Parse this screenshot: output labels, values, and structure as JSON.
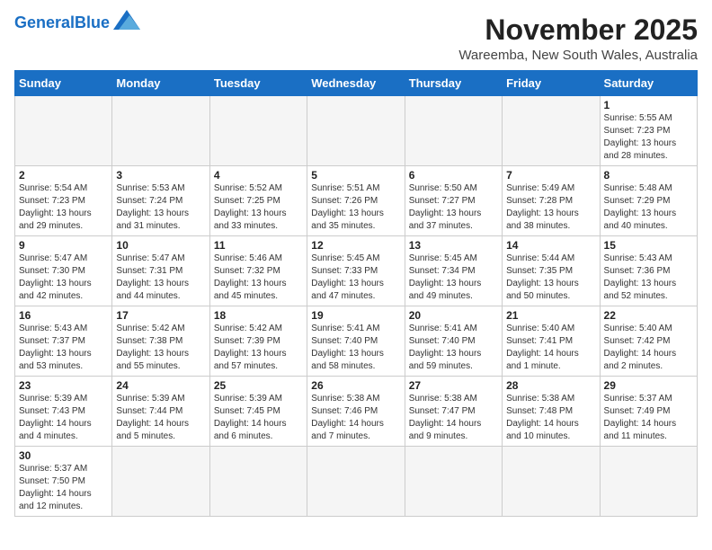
{
  "header": {
    "logo_general": "General",
    "logo_blue": "Blue",
    "month_title": "November 2025",
    "location": "Wareemba, New South Wales, Australia"
  },
  "days_of_week": [
    "Sunday",
    "Monday",
    "Tuesday",
    "Wednesday",
    "Thursday",
    "Friday",
    "Saturday"
  ],
  "weeks": [
    [
      {
        "day": "",
        "info": ""
      },
      {
        "day": "",
        "info": ""
      },
      {
        "day": "",
        "info": ""
      },
      {
        "day": "",
        "info": ""
      },
      {
        "day": "",
        "info": ""
      },
      {
        "day": "",
        "info": ""
      },
      {
        "day": "1",
        "info": "Sunrise: 5:55 AM\nSunset: 7:23 PM\nDaylight: 13 hours\nand 28 minutes."
      }
    ],
    [
      {
        "day": "2",
        "info": "Sunrise: 5:54 AM\nSunset: 7:23 PM\nDaylight: 13 hours\nand 29 minutes."
      },
      {
        "day": "3",
        "info": "Sunrise: 5:53 AM\nSunset: 7:24 PM\nDaylight: 13 hours\nand 31 minutes."
      },
      {
        "day": "4",
        "info": "Sunrise: 5:52 AM\nSunset: 7:25 PM\nDaylight: 13 hours\nand 33 minutes."
      },
      {
        "day": "5",
        "info": "Sunrise: 5:51 AM\nSunset: 7:26 PM\nDaylight: 13 hours\nand 35 minutes."
      },
      {
        "day": "6",
        "info": "Sunrise: 5:50 AM\nSunset: 7:27 PM\nDaylight: 13 hours\nand 37 minutes."
      },
      {
        "day": "7",
        "info": "Sunrise: 5:49 AM\nSunset: 7:28 PM\nDaylight: 13 hours\nand 38 minutes."
      },
      {
        "day": "8",
        "info": "Sunrise: 5:48 AM\nSunset: 7:29 PM\nDaylight: 13 hours\nand 40 minutes."
      }
    ],
    [
      {
        "day": "9",
        "info": "Sunrise: 5:47 AM\nSunset: 7:30 PM\nDaylight: 13 hours\nand 42 minutes."
      },
      {
        "day": "10",
        "info": "Sunrise: 5:47 AM\nSunset: 7:31 PM\nDaylight: 13 hours\nand 44 minutes."
      },
      {
        "day": "11",
        "info": "Sunrise: 5:46 AM\nSunset: 7:32 PM\nDaylight: 13 hours\nand 45 minutes."
      },
      {
        "day": "12",
        "info": "Sunrise: 5:45 AM\nSunset: 7:33 PM\nDaylight: 13 hours\nand 47 minutes."
      },
      {
        "day": "13",
        "info": "Sunrise: 5:45 AM\nSunset: 7:34 PM\nDaylight: 13 hours\nand 49 minutes."
      },
      {
        "day": "14",
        "info": "Sunrise: 5:44 AM\nSunset: 7:35 PM\nDaylight: 13 hours\nand 50 minutes."
      },
      {
        "day": "15",
        "info": "Sunrise: 5:43 AM\nSunset: 7:36 PM\nDaylight: 13 hours\nand 52 minutes."
      }
    ],
    [
      {
        "day": "16",
        "info": "Sunrise: 5:43 AM\nSunset: 7:37 PM\nDaylight: 13 hours\nand 53 minutes."
      },
      {
        "day": "17",
        "info": "Sunrise: 5:42 AM\nSunset: 7:38 PM\nDaylight: 13 hours\nand 55 minutes."
      },
      {
        "day": "18",
        "info": "Sunrise: 5:42 AM\nSunset: 7:39 PM\nDaylight: 13 hours\nand 57 minutes."
      },
      {
        "day": "19",
        "info": "Sunrise: 5:41 AM\nSunset: 7:40 PM\nDaylight: 13 hours\nand 58 minutes."
      },
      {
        "day": "20",
        "info": "Sunrise: 5:41 AM\nSunset: 7:40 PM\nDaylight: 13 hours\nand 59 minutes."
      },
      {
        "day": "21",
        "info": "Sunrise: 5:40 AM\nSunset: 7:41 PM\nDaylight: 14 hours\nand 1 minute."
      },
      {
        "day": "22",
        "info": "Sunrise: 5:40 AM\nSunset: 7:42 PM\nDaylight: 14 hours\nand 2 minutes."
      }
    ],
    [
      {
        "day": "23",
        "info": "Sunrise: 5:39 AM\nSunset: 7:43 PM\nDaylight: 14 hours\nand 4 minutes."
      },
      {
        "day": "24",
        "info": "Sunrise: 5:39 AM\nSunset: 7:44 PM\nDaylight: 14 hours\nand 5 minutes."
      },
      {
        "day": "25",
        "info": "Sunrise: 5:39 AM\nSunset: 7:45 PM\nDaylight: 14 hours\nand 6 minutes."
      },
      {
        "day": "26",
        "info": "Sunrise: 5:38 AM\nSunset: 7:46 PM\nDaylight: 14 hours\nand 7 minutes."
      },
      {
        "day": "27",
        "info": "Sunrise: 5:38 AM\nSunset: 7:47 PM\nDaylight: 14 hours\nand 9 minutes."
      },
      {
        "day": "28",
        "info": "Sunrise: 5:38 AM\nSunset: 7:48 PM\nDaylight: 14 hours\nand 10 minutes."
      },
      {
        "day": "29",
        "info": "Sunrise: 5:37 AM\nSunset: 7:49 PM\nDaylight: 14 hours\nand 11 minutes."
      }
    ],
    [
      {
        "day": "30",
        "info": "Sunrise: 5:37 AM\nSunset: 7:50 PM\nDaylight: 14 hours\nand 12 minutes."
      },
      {
        "day": "",
        "info": ""
      },
      {
        "day": "",
        "info": ""
      },
      {
        "day": "",
        "info": ""
      },
      {
        "day": "",
        "info": ""
      },
      {
        "day": "",
        "info": ""
      },
      {
        "day": "",
        "info": ""
      }
    ]
  ]
}
